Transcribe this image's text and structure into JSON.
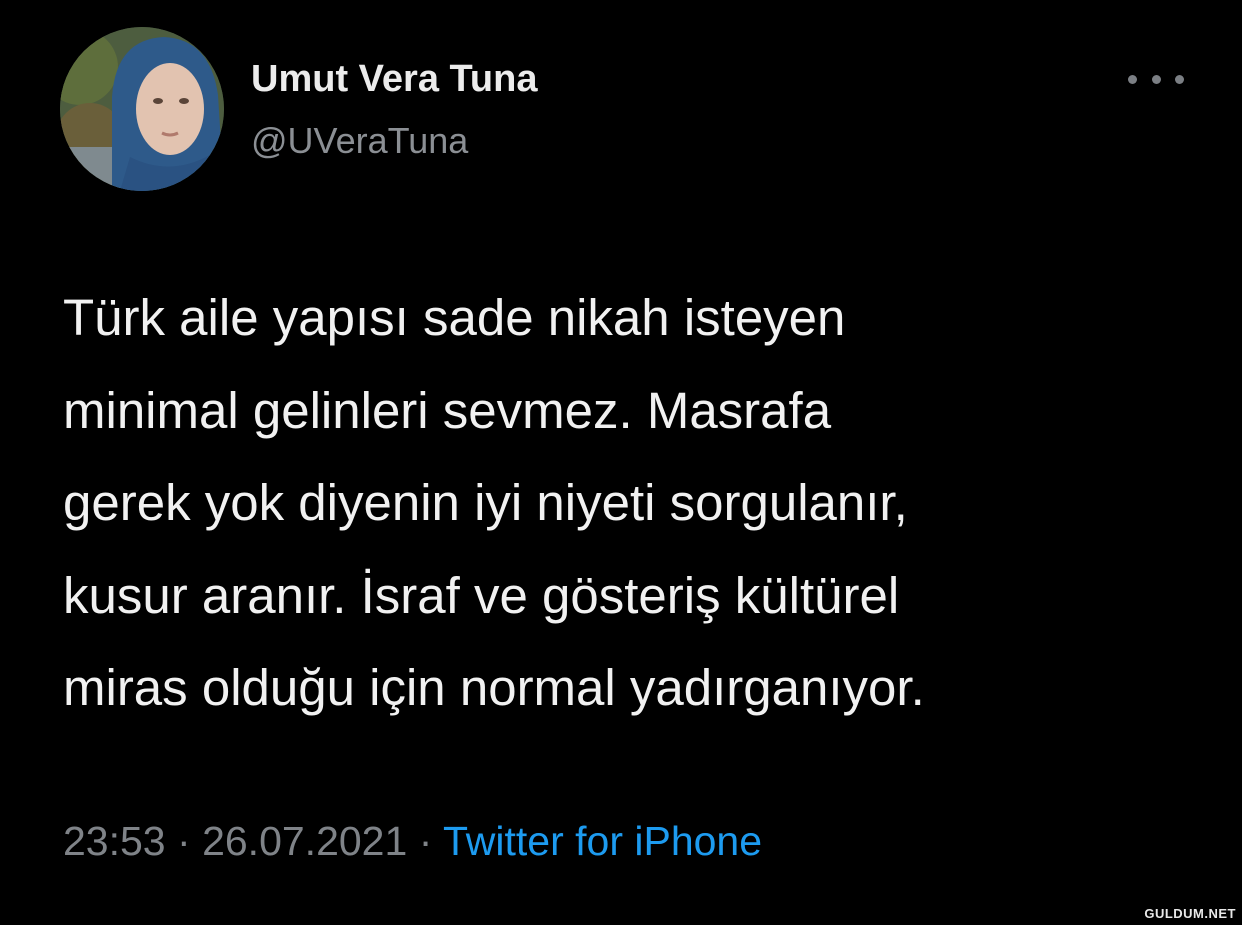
{
  "tweet": {
    "author": {
      "display_name": "Umut Vera Tuna",
      "handle": "@UVeraTuna",
      "avatar_icon": "profile-photo"
    },
    "more_icon": "more-horizontal-icon",
    "text_lines": [
      "Türk aile yapısı sade nikah isteyen",
      "minimal gelinleri sevmez. Masrafa",
      "gerek yok diyenin iyi niyeti sorgulanır,",
      "kusur aranır. İsraf ve gösteriş kültürel",
      "miras olduğu için normal yadırganıyor."
    ],
    "time": "23:53",
    "date": "26.07.2021",
    "separator": "·",
    "source": "Twitter for iPhone"
  },
  "watermark": "GULDUM.NET",
  "colors": {
    "background": "#000000",
    "text": "#f1f1f1",
    "secondary": "#7f8388",
    "link": "#1d9bf0"
  }
}
